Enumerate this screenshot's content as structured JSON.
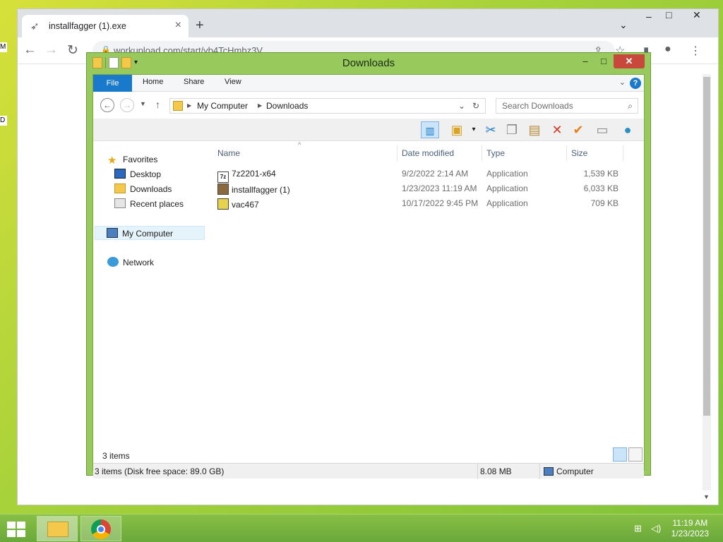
{
  "chrome": {
    "tab_title": "installfagger (1).exe",
    "url": "workupload.com/start/yb4TcHmbz3V"
  },
  "explorer": {
    "title": "Downloads",
    "ribbon_tabs": [
      "File",
      "Home",
      "Share",
      "View"
    ],
    "path": [
      "My Computer",
      "Downloads"
    ],
    "search_placeholder": "Search Downloads",
    "nav": {
      "favorites": "Favorites",
      "desktop": "Desktop",
      "downloads": "Downloads",
      "recent": "Recent places",
      "computer": "My Computer",
      "network": "Network"
    },
    "columns": [
      "Name",
      "Date modified",
      "Type",
      "Size"
    ],
    "files": [
      {
        "name": "7z2201-x64",
        "date": "9/2/2022 2:14 AM",
        "type": "Application",
        "size": "1,539 KB"
      },
      {
        "name": "installfagger (1)",
        "date": "1/23/2023 11:19 AM",
        "type": "Application",
        "size": "6,033 KB"
      },
      {
        "name": "vac467",
        "date": "10/17/2022 9:45 PM",
        "type": "Application",
        "size": "709 KB"
      }
    ],
    "item_count": "3 items",
    "status": {
      "left": "3 items (Disk free space: 89.0 GB)",
      "size": "8.08 MB",
      "location": "Computer"
    }
  },
  "taskbar": {
    "time": "11:19 AM",
    "date": "1/23/2023"
  }
}
